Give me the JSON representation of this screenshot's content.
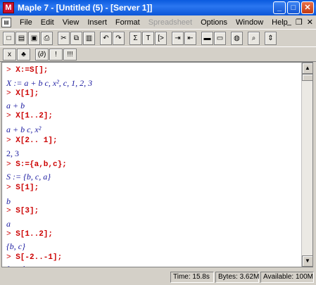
{
  "window": {
    "title": "Maple 7 - [Untitled (5) - [Server 1]]",
    "app_icon": "M",
    "min_glyph": "_",
    "max_glyph": "□",
    "close_glyph": "✕"
  },
  "menu": {
    "items": [
      "File",
      "Edit",
      "View",
      "Insert",
      "Format",
      "Spreadsheet",
      "Options",
      "Window",
      "Help"
    ],
    "disabled": [
      "Spreadsheet"
    ],
    "doc_min": "_",
    "doc_restore": "❐",
    "doc_close": "✕"
  },
  "toolbar1": {
    "buttons": [
      "new-icon",
      "open-icon",
      "save-icon",
      "print-icon",
      "cut-icon",
      "copy-icon",
      "paste-icon",
      "undo-icon",
      "redo-icon",
      "sigma-icon",
      "text-icon",
      "prompt-icon",
      "indent-icon",
      "outdent-icon",
      "collapse-icon",
      "expand-icon",
      "stop-icon",
      "zoom-icon",
      "scroll-icon"
    ],
    "glyphs": [
      "□",
      "▤",
      "▣",
      "⎙",
      "✂",
      "⧉",
      "▥",
      "↶",
      "↷",
      "Σ",
      "T",
      "[>",
      "⇥",
      "⇤",
      "▬",
      "▭",
      "◍",
      "⌕",
      "⇕"
    ]
  },
  "toolbar2": {
    "buttons": [
      "math-mode-icon",
      "plant-icon",
      "text-mode-icon",
      "execute-icon",
      "execute-all-icon"
    ],
    "glyphs": [
      "x",
      "♣",
      "(∂)",
      "!",
      "!!!"
    ]
  },
  "worksheet": {
    "lines": [
      {
        "kind": "input",
        "prompt": "> ",
        "text": "X:=S[];"
      },
      {
        "kind": "output",
        "text": "X := a + b c, x², c, 1, 2, 3"
      },
      {
        "kind": "input",
        "prompt": "> ",
        "text": "X[1];"
      },
      {
        "kind": "output",
        "text": "a + b"
      },
      {
        "kind": "input",
        "prompt": "> ",
        "text": "X[1..2];"
      },
      {
        "kind": "output",
        "text": "a + b c, x²"
      },
      {
        "kind": "input",
        "prompt": "> ",
        "text": "X[2.. 1];"
      },
      {
        "kind": "output-upright",
        "text": "2, 3"
      },
      {
        "kind": "input",
        "prompt": "> ",
        "text": "S:={a,b,c};"
      },
      {
        "kind": "output",
        "text": "S := {b, c, a}"
      },
      {
        "kind": "input",
        "prompt": "> ",
        "text": "S[1];"
      },
      {
        "kind": "output",
        "text": "b"
      },
      {
        "kind": "input",
        "prompt": "> ",
        "text": "S[3];"
      },
      {
        "kind": "output",
        "text": "a"
      },
      {
        "kind": "input",
        "prompt": "> ",
        "text": "S[1..2];"
      },
      {
        "kind": "output",
        "text": "{b, c}"
      },
      {
        "kind": "input",
        "prompt": "> ",
        "text": "S[-2..-1];"
      },
      {
        "kind": "output",
        "text": "{c, a}"
      }
    ]
  },
  "status": {
    "time": "Time: 15.8s",
    "bytes": "Bytes: 3.62M",
    "available": "Available: 100M"
  }
}
